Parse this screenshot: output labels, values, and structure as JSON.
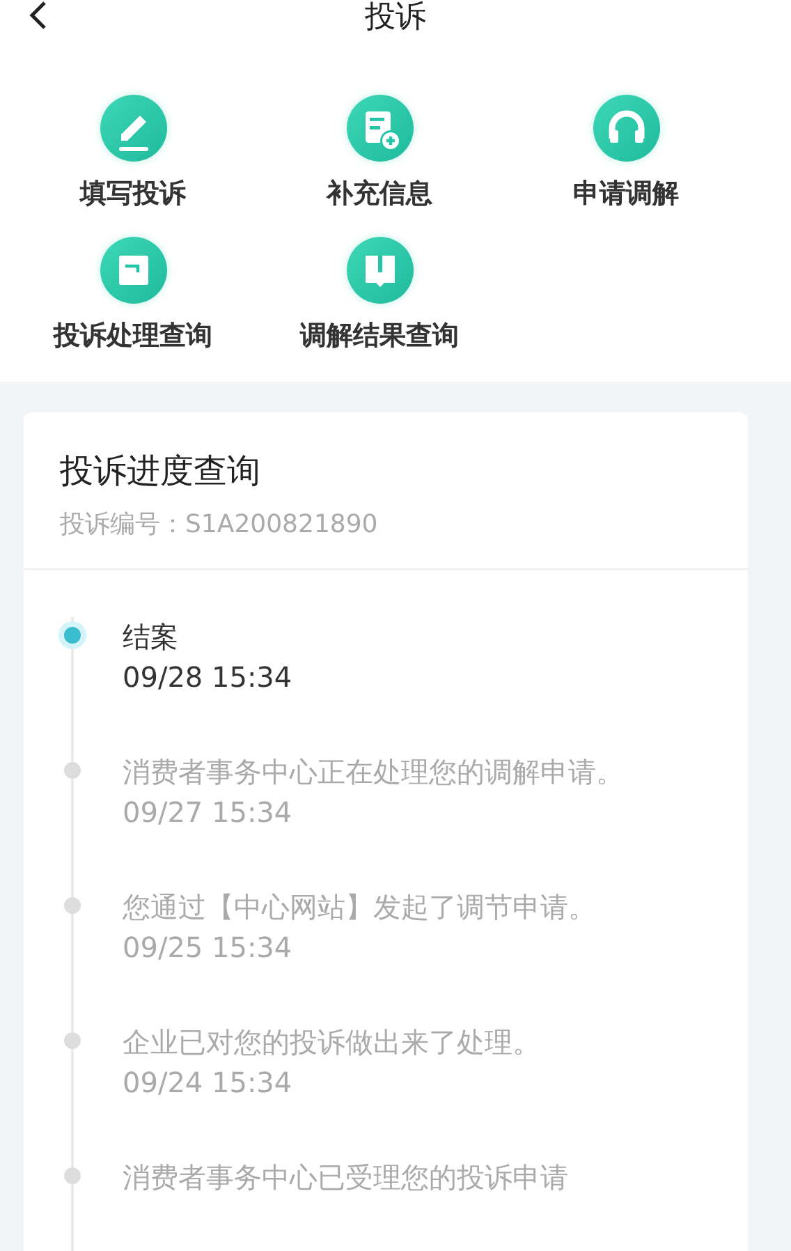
{
  "header": {
    "title": "投诉"
  },
  "actions": [
    {
      "kind": "pen",
      "label": "填写投诉"
    },
    {
      "kind": "form",
      "label": "补充信息"
    },
    {
      "kind": "headset",
      "label": "申请调解"
    },
    {
      "kind": "box",
      "label": "投诉处理查询"
    },
    {
      "kind": "book",
      "label": "调解结果查询"
    }
  ],
  "progress": {
    "title": "投诉进度查询",
    "number": "投诉编号：S1A200821890",
    "events": [
      {
        "text": "结案",
        "time": "09/28 15:34",
        "selected": true
      },
      {
        "text": "消费者事务中心正在处理您的调解申请。",
        "time": "09/27 15:34",
        "selected": false
      },
      {
        "text": "您通过【中心网站】发起了调节申请。",
        "time": "09/25 15:34",
        "selected": false
      },
      {
        "text": "企业已对您的投诉做出来了处理。",
        "time": "09/24 15:34",
        "selected": false
      },
      {
        "text": "消费者事务中心已受理您的投诉申请",
        "selected": false
      }
    ]
  }
}
